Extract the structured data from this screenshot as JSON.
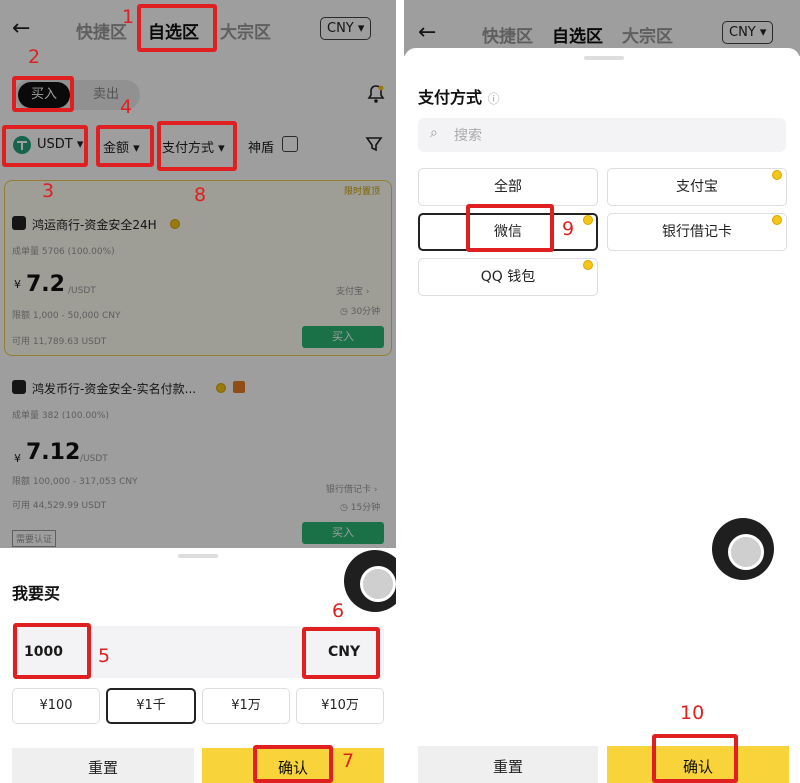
{
  "header": {
    "tabs": [
      "快捷区",
      "自选区",
      "大宗区"
    ],
    "currency": "CNY ▾"
  },
  "left": {
    "toggle": {
      "buy": "买入",
      "sell": "卖出"
    },
    "filters": {
      "coin": "USDT",
      "amount": "金额",
      "payment": "支付方式",
      "shield": "神盾"
    },
    "tag": "限时置顶",
    "offers": [
      {
        "merchant": "鸿运商行-资金安全24H",
        "orders": "成单量 5706 (100.00%)",
        "currency_symbol": "¥",
        "price": "7.2",
        "unit": "/USDT",
        "limit": "限额 1,000 - 50,000 CNY",
        "available": "可用 11,789.63 USDT",
        "payment": "支付宝 ›",
        "time": "30分钟",
        "buy": "买入"
      },
      {
        "merchant": "鸿发币行-资金安全-实名付款...",
        "orders": "成单量 382 (100.00%)",
        "currency_symbol": "¥",
        "price": "7.12",
        "unit": "/USDT",
        "limit": "限额 100,000 - 317,053 CNY",
        "available": "可用 44,529.99 USDT",
        "payment": "银行借记卡 ›",
        "time": "15分钟",
        "buy": "买入",
        "badge": "需要认证"
      }
    ],
    "sheet": {
      "title": "我要买",
      "amount_value": "1000",
      "currency": "CNY",
      "quick_amounts": [
        "¥100",
        "¥1千",
        "¥1万",
        "¥10万"
      ],
      "reset": "重置",
      "confirm": "确认"
    }
  },
  "right": {
    "sheet": {
      "title": "支付方式",
      "search_placeholder": "搜索",
      "methods": [
        "全部",
        "支付宝",
        "微信",
        "银行借记卡",
        "QQ 钱包"
      ],
      "reset": "重置",
      "confirm": "确认"
    }
  },
  "annotations": [
    "1",
    "2",
    "3",
    "4",
    "5",
    "6",
    "7",
    "8",
    "9",
    "10"
  ],
  "colors": {
    "accent": "#f8d33a",
    "annotation": "#e02020",
    "buy_green": "#2bb673"
  }
}
